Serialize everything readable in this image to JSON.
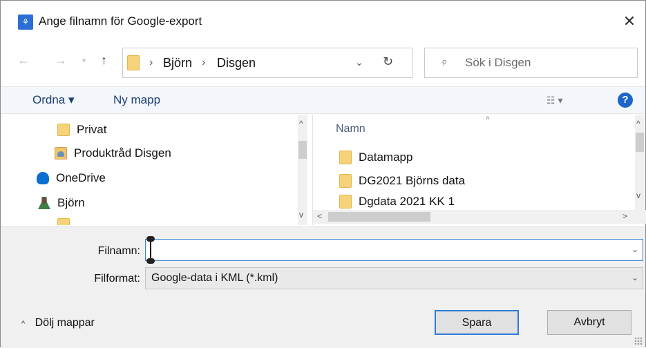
{
  "window": {
    "title": "Ange filnamn för Google-export",
    "close_glyph": "✕",
    "app_icon_glyph": "꽃"
  },
  "navigation": {
    "back_glyph": "←",
    "forward_glyph": "→",
    "recent_glyph": "▾",
    "up_glyph": "↑",
    "breadcrumb": [
      "Björn",
      "Disgen"
    ],
    "crumb_separator": "›",
    "dropdown_glyph": "⌄",
    "refresh_glyph": "↻"
  },
  "search": {
    "placeholder": "Sök i Disgen",
    "icon_glyph": "⌕"
  },
  "toolbar": {
    "organize_label": "Ordna ▾",
    "new_folder_label": "Ny mapp",
    "view_glyph": "☷ ▾",
    "help_glyph": "?"
  },
  "nav_pane": {
    "items": [
      {
        "label": "Privat",
        "icon": "folder-icon"
      },
      {
        "label": "Produktråd Disgen",
        "icon": "shared-folder-icon"
      },
      {
        "label": "OneDrive",
        "icon": "cloud-icon"
      },
      {
        "label": "Björn",
        "icon": "user-icon"
      },
      {
        "label": "",
        "icon": "folder-icon"
      }
    ],
    "scroll_up": "^",
    "scroll_down": "v"
  },
  "file_list": {
    "column_name": "Namn",
    "sort_glyph": "^",
    "rows": [
      {
        "name": "Datamapp"
      },
      {
        "name": "DG2021 Björns data"
      },
      {
        "name": "Dgdata 2021 KK 1"
      }
    ],
    "scroll_left": "<",
    "scroll_right": ">"
  },
  "form": {
    "filename_label": "Filnamn:",
    "filename_value": "",
    "filetype_label": "Filformat:",
    "filetype_value": "Google-data i KML (*.kml)",
    "chevron": "⌄"
  },
  "footer": {
    "hide_folders_label": "Dölj mappar",
    "hide_folders_chevron": "^",
    "save_label": "Spara",
    "cancel_label": "Avbryt"
  },
  "colors": {
    "accent": "#2f7ad6",
    "help": "#1d66c7",
    "folder": "#f6d27a"
  }
}
